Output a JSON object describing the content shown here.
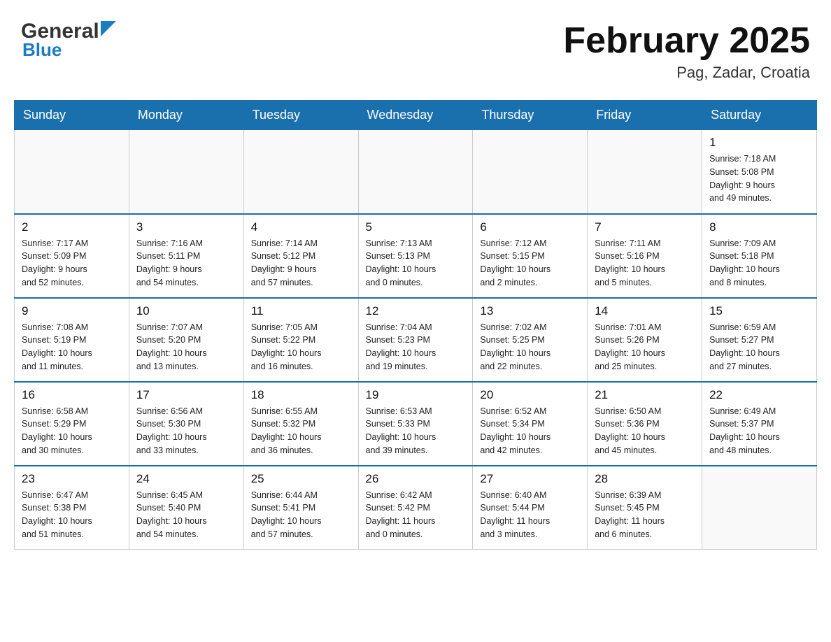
{
  "header": {
    "logo_line1": "General",
    "logo_line2": "Blue",
    "title": "February 2025",
    "location": "Pag, Zadar, Croatia"
  },
  "days_of_week": [
    "Sunday",
    "Monday",
    "Tuesday",
    "Wednesday",
    "Thursday",
    "Friday",
    "Saturday"
  ],
  "weeks": [
    [
      {
        "day": "",
        "info": ""
      },
      {
        "day": "",
        "info": ""
      },
      {
        "day": "",
        "info": ""
      },
      {
        "day": "",
        "info": ""
      },
      {
        "day": "",
        "info": ""
      },
      {
        "day": "",
        "info": ""
      },
      {
        "day": "1",
        "info": "Sunrise: 7:18 AM\nSunset: 5:08 PM\nDaylight: 9 hours\nand 49 minutes."
      }
    ],
    [
      {
        "day": "2",
        "info": "Sunrise: 7:17 AM\nSunset: 5:09 PM\nDaylight: 9 hours\nand 52 minutes."
      },
      {
        "day": "3",
        "info": "Sunrise: 7:16 AM\nSunset: 5:11 PM\nDaylight: 9 hours\nand 54 minutes."
      },
      {
        "day": "4",
        "info": "Sunrise: 7:14 AM\nSunset: 5:12 PM\nDaylight: 9 hours\nand 57 minutes."
      },
      {
        "day": "5",
        "info": "Sunrise: 7:13 AM\nSunset: 5:13 PM\nDaylight: 10 hours\nand 0 minutes."
      },
      {
        "day": "6",
        "info": "Sunrise: 7:12 AM\nSunset: 5:15 PM\nDaylight: 10 hours\nand 2 minutes."
      },
      {
        "day": "7",
        "info": "Sunrise: 7:11 AM\nSunset: 5:16 PM\nDaylight: 10 hours\nand 5 minutes."
      },
      {
        "day": "8",
        "info": "Sunrise: 7:09 AM\nSunset: 5:18 PM\nDaylight: 10 hours\nand 8 minutes."
      }
    ],
    [
      {
        "day": "9",
        "info": "Sunrise: 7:08 AM\nSunset: 5:19 PM\nDaylight: 10 hours\nand 11 minutes."
      },
      {
        "day": "10",
        "info": "Sunrise: 7:07 AM\nSunset: 5:20 PM\nDaylight: 10 hours\nand 13 minutes."
      },
      {
        "day": "11",
        "info": "Sunrise: 7:05 AM\nSunset: 5:22 PM\nDaylight: 10 hours\nand 16 minutes."
      },
      {
        "day": "12",
        "info": "Sunrise: 7:04 AM\nSunset: 5:23 PM\nDaylight: 10 hours\nand 19 minutes."
      },
      {
        "day": "13",
        "info": "Sunrise: 7:02 AM\nSunset: 5:25 PM\nDaylight: 10 hours\nand 22 minutes."
      },
      {
        "day": "14",
        "info": "Sunrise: 7:01 AM\nSunset: 5:26 PM\nDaylight: 10 hours\nand 25 minutes."
      },
      {
        "day": "15",
        "info": "Sunrise: 6:59 AM\nSunset: 5:27 PM\nDaylight: 10 hours\nand 27 minutes."
      }
    ],
    [
      {
        "day": "16",
        "info": "Sunrise: 6:58 AM\nSunset: 5:29 PM\nDaylight: 10 hours\nand 30 minutes."
      },
      {
        "day": "17",
        "info": "Sunrise: 6:56 AM\nSunset: 5:30 PM\nDaylight: 10 hours\nand 33 minutes."
      },
      {
        "day": "18",
        "info": "Sunrise: 6:55 AM\nSunset: 5:32 PM\nDaylight: 10 hours\nand 36 minutes."
      },
      {
        "day": "19",
        "info": "Sunrise: 6:53 AM\nSunset: 5:33 PM\nDaylight: 10 hours\nand 39 minutes."
      },
      {
        "day": "20",
        "info": "Sunrise: 6:52 AM\nSunset: 5:34 PM\nDaylight: 10 hours\nand 42 minutes."
      },
      {
        "day": "21",
        "info": "Sunrise: 6:50 AM\nSunset: 5:36 PM\nDaylight: 10 hours\nand 45 minutes."
      },
      {
        "day": "22",
        "info": "Sunrise: 6:49 AM\nSunset: 5:37 PM\nDaylight: 10 hours\nand 48 minutes."
      }
    ],
    [
      {
        "day": "23",
        "info": "Sunrise: 6:47 AM\nSunset: 5:38 PM\nDaylight: 10 hours\nand 51 minutes."
      },
      {
        "day": "24",
        "info": "Sunrise: 6:45 AM\nSunset: 5:40 PM\nDaylight: 10 hours\nand 54 minutes."
      },
      {
        "day": "25",
        "info": "Sunrise: 6:44 AM\nSunset: 5:41 PM\nDaylight: 10 hours\nand 57 minutes."
      },
      {
        "day": "26",
        "info": "Sunrise: 6:42 AM\nSunset: 5:42 PM\nDaylight: 11 hours\nand 0 minutes."
      },
      {
        "day": "27",
        "info": "Sunrise: 6:40 AM\nSunset: 5:44 PM\nDaylight: 11 hours\nand 3 minutes."
      },
      {
        "day": "28",
        "info": "Sunrise: 6:39 AM\nSunset: 5:45 PM\nDaylight: 11 hours\nand 6 minutes."
      },
      {
        "day": "",
        "info": ""
      }
    ]
  ]
}
